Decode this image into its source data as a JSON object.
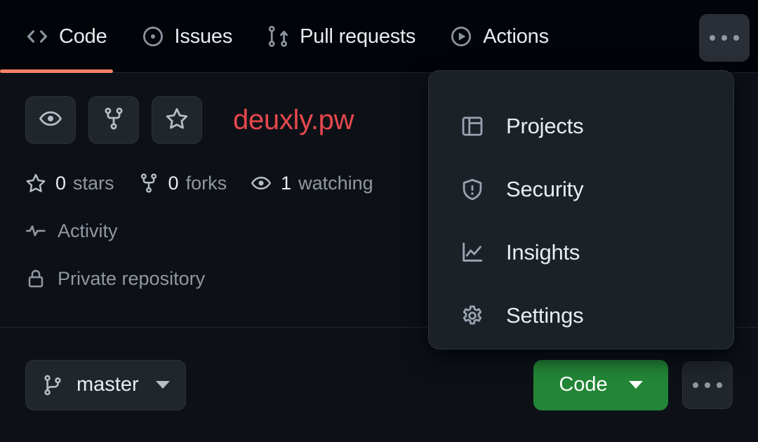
{
  "colors": {
    "page_bg": "#0d1117",
    "nav_bg": "#010409",
    "accent_underline": "#f78166",
    "repo_title": "#e5484d",
    "code_button_green": "#238636",
    "menu_bg": "#1c2128",
    "muted_text": "#9198a1"
  },
  "nav": {
    "items": [
      {
        "label": "Code",
        "icon": "code-icon",
        "selected": true
      },
      {
        "label": "Issues",
        "icon": "issue-opened-icon",
        "selected": false
      },
      {
        "label": "Pull requests",
        "icon": "git-pull-request-icon",
        "selected": false
      },
      {
        "label": "Actions",
        "icon": "play-circle-icon",
        "selected": false
      }
    ],
    "overflow": {
      "label": "More",
      "icon": "kebab-horizontal-icon",
      "expanded": true
    }
  },
  "repo": {
    "title": "deuxly.pw",
    "actions": [
      {
        "name": "watch-button",
        "icon": "eye-icon"
      },
      {
        "name": "fork-button",
        "icon": "repo-forked-icon"
      },
      {
        "name": "star-button",
        "icon": "star-icon"
      }
    ],
    "stats": [
      {
        "count": "0",
        "label": "stars",
        "icon": "star-icon"
      },
      {
        "count": "0",
        "label": "forks",
        "icon": "repo-forked-icon"
      },
      {
        "count": "1",
        "label": "watching",
        "icon": "eye-icon"
      }
    ],
    "activity": {
      "label": "Activity",
      "icon": "pulse-icon"
    },
    "visibility": {
      "label": "Private repository",
      "icon": "lock-icon"
    }
  },
  "menu": {
    "items": [
      {
        "label": "Projects",
        "icon": "project-table-icon"
      },
      {
        "label": "Security",
        "icon": "shield-alert-icon"
      },
      {
        "label": "Insights",
        "icon": "graph-line-icon"
      },
      {
        "label": "Settings",
        "icon": "gear-icon"
      }
    ]
  },
  "toolbar": {
    "branch": {
      "label": "master",
      "icon": "git-branch-icon"
    },
    "code_button": {
      "label": "Code",
      "icon": "chevron-down-icon"
    },
    "overflow_button": {
      "label": "More options",
      "icon": "kebab-horizontal-icon"
    }
  }
}
